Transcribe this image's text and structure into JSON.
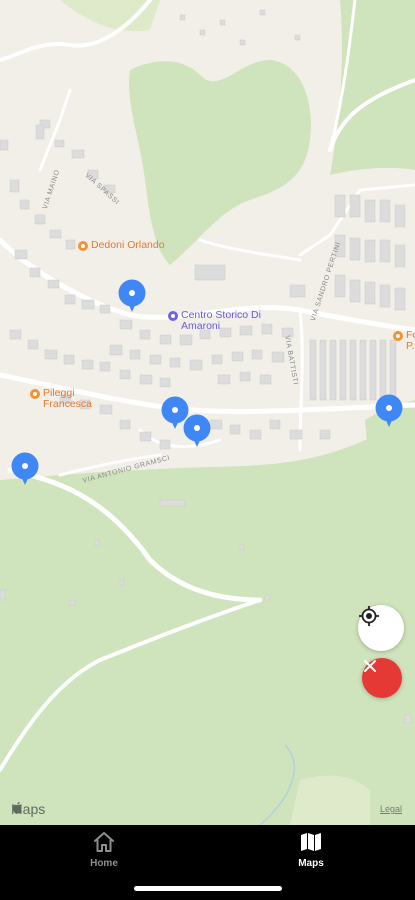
{
  "map": {
    "pois": [
      {
        "name": "Dedoni Orlando",
        "kind": "orange"
      },
      {
        "name": "Centro Storico Di Amaroni",
        "kind": "purple"
      },
      {
        "name": "Pileggi Francesca",
        "kind": "orange"
      },
      {
        "name": "Fo... P...",
        "kind": "orange"
      }
    ],
    "streets": [
      "VIA MAINO",
      "VIA SPASSI",
      "VIA SANDRO PERTINI",
      "VIA BATTISTI",
      "VIA ANTONIO GRAMSCI"
    ],
    "attribution": "Maps",
    "legal": "Legal",
    "colors": {
      "land": "#f2efe9",
      "green": "#cfe3bc",
      "pin": "#3f87f5"
    }
  },
  "controls": {
    "locate_icon": "target-icon",
    "close_icon": "close-x-icon"
  },
  "tabbar": {
    "home_label": "Home",
    "maps_label": "Maps",
    "active": "Maps"
  }
}
